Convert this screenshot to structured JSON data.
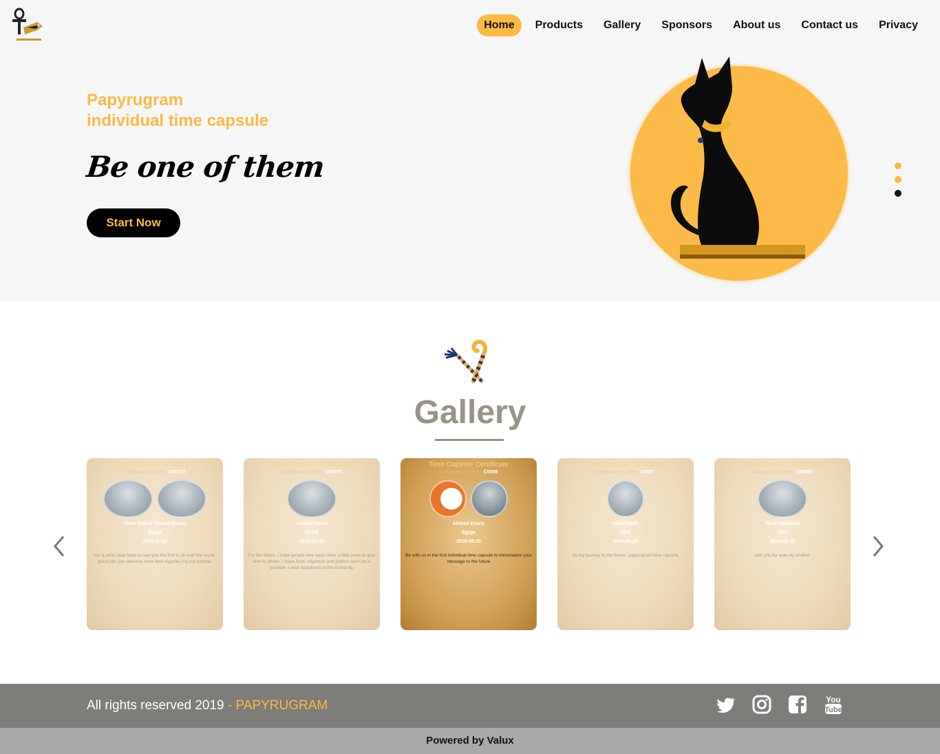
{
  "nav": {
    "items": [
      {
        "label": "Home",
        "active": true
      },
      {
        "label": "Products",
        "active": false
      },
      {
        "label": "Gallery",
        "active": false
      },
      {
        "label": "Sponsors",
        "active": false
      },
      {
        "label": "About us",
        "active": false
      },
      {
        "label": "Contact us",
        "active": false
      },
      {
        "label": "Privacy",
        "active": false
      }
    ]
  },
  "hero": {
    "subtitle_line1": "Papyrugram",
    "subtitle_line2": "individual time capsule",
    "title": "Be one of them",
    "cta_label": "Start Now",
    "slides": 3,
    "current_slide": 3
  },
  "gallery": {
    "title": "Gallery",
    "cards": [
      {
        "heading": "Time Capsule Certificate",
        "cert_label": "Certificate Number :",
        "cert_number": "C00072",
        "name": "Amer Diab & Ahmed Enany",
        "country": "Egypt",
        "date": "2019-11-13",
        "message": "me & amer diab hope to see you the first in all over the world. great job. you deserve more best regaries my top popstar"
      },
      {
        "heading": "Time Capsule Certificate",
        "cert_label": "Certificate Number :",
        "cert_number": "C00071",
        "name": "Juliana Vieira",
        "country": "Brazil",
        "date": "2019-08-29",
        "message": "For the future, I hope people love each other a little more to give love to others. I hope food, migration and politics won't be a problem. I wish happiness to the humanity."
      },
      {
        "heading": "Time Capsule Certificate",
        "cert_label": "Certificate Number :",
        "cert_number": "C0008",
        "name": "Ahmed Enany",
        "country": "Egypt",
        "date": "2019-08-20",
        "message": "Be with us in the first individual time capsule to immortalize your message to the future"
      },
      {
        "heading": "Time Capsule Certificate",
        "cert_label": "Certificate Number :",
        "cert_number": "C0007",
        "name": "Islam Rafik",
        "country": "USA",
        "date": "2019-08-15",
        "message": "its my journey to the future. papyrugram time capsule"
      },
      {
        "heading": "Time Capsule Certificate",
        "cert_label": "Certificate Number :",
        "cert_number": "C00005",
        "name": "Tarek Ibrahame",
        "country": "USA",
        "date": "2019-08-18",
        "message": "with you for ever my brother"
      }
    ]
  },
  "footer": {
    "copyright": "All rights reserved 2019",
    "separator": " - ",
    "brand": "PAPYRUGRAM",
    "social": [
      "twitter-icon",
      "instagram-icon",
      "facebook-icon",
      "youtube-icon"
    ],
    "powered_by": "Powered by Valux"
  },
  "colors": {
    "accent": "#fcb944",
    "hero_bg": "#f6f6f6",
    "footer_bg": "#7e7d79",
    "powered_bg": "#a9a9a9",
    "gallery_title": "#9a9388"
  }
}
